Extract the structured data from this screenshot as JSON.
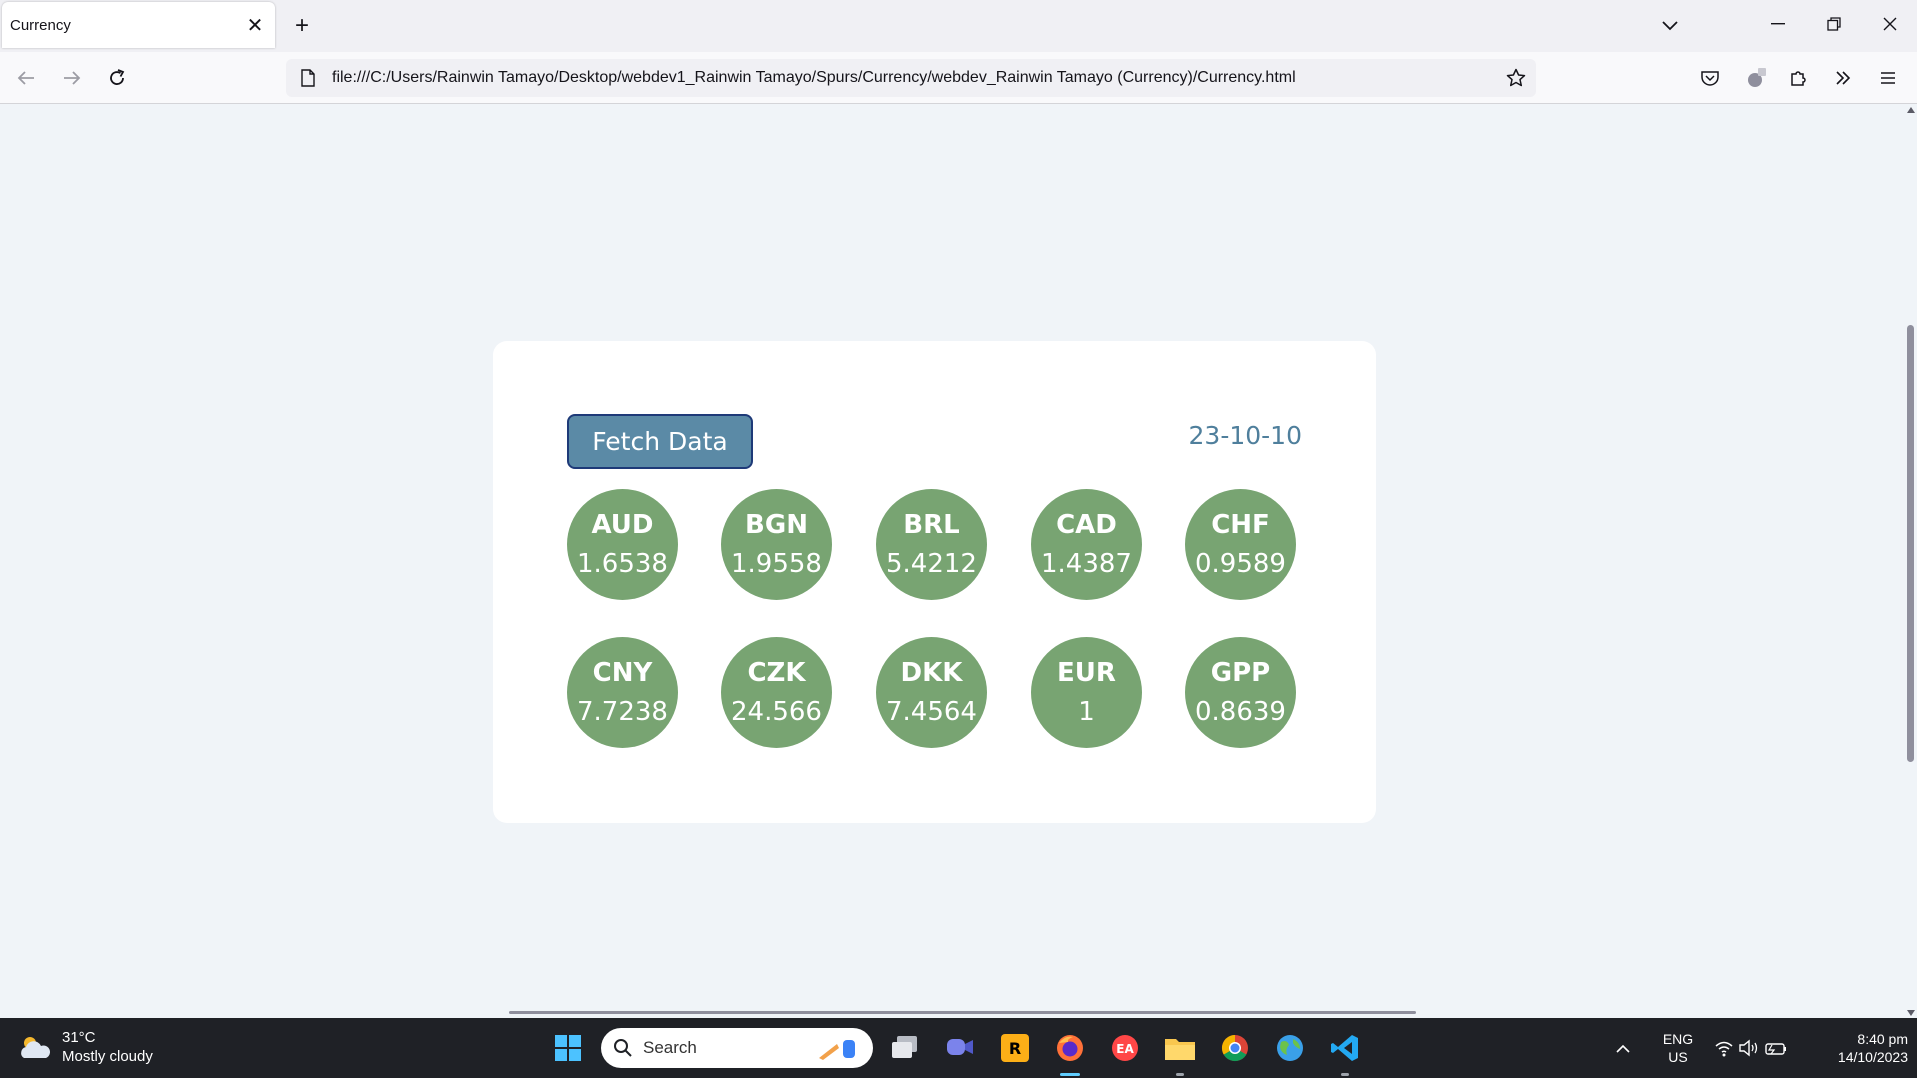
{
  "browser": {
    "tab_title": "Currency",
    "url": "file:///C:/Users/Rainwin Tamayo/Desktop/webdev1_Rainwin Tamayo/Spurs/Currency/webdev_Rainwin Tamayo (Currency)/Currency.html"
  },
  "page": {
    "fetch_button_label": "Fetch Data",
    "date": "23-10-10",
    "currencies": [
      {
        "code": "AUD",
        "rate": "1.6538"
      },
      {
        "code": "BGN",
        "rate": "1.9558"
      },
      {
        "code": "BRL",
        "rate": "5.4212"
      },
      {
        "code": "CAD",
        "rate": "1.4387"
      },
      {
        "code": "CHF",
        "rate": "0.9589"
      },
      {
        "code": "CNY",
        "rate": "7.7238"
      },
      {
        "code": "CZK",
        "rate": "24.566"
      },
      {
        "code": "DKK",
        "rate": "7.4564"
      },
      {
        "code": "EUR",
        "rate": "1"
      },
      {
        "code": "GPP",
        "rate": "0.8639"
      }
    ],
    "colors": {
      "coin": "#78a472",
      "button": "#5b8aa6",
      "date": "#4f7f9c",
      "background": "#f0f4f8"
    }
  },
  "taskbar": {
    "weather_temp": "31°C",
    "weather_desc": "Mostly cloudy",
    "search_label": "Search",
    "lang_top": "ENG",
    "lang_bottom": "US",
    "time": "8:40 pm",
    "date": "14/10/2023"
  }
}
